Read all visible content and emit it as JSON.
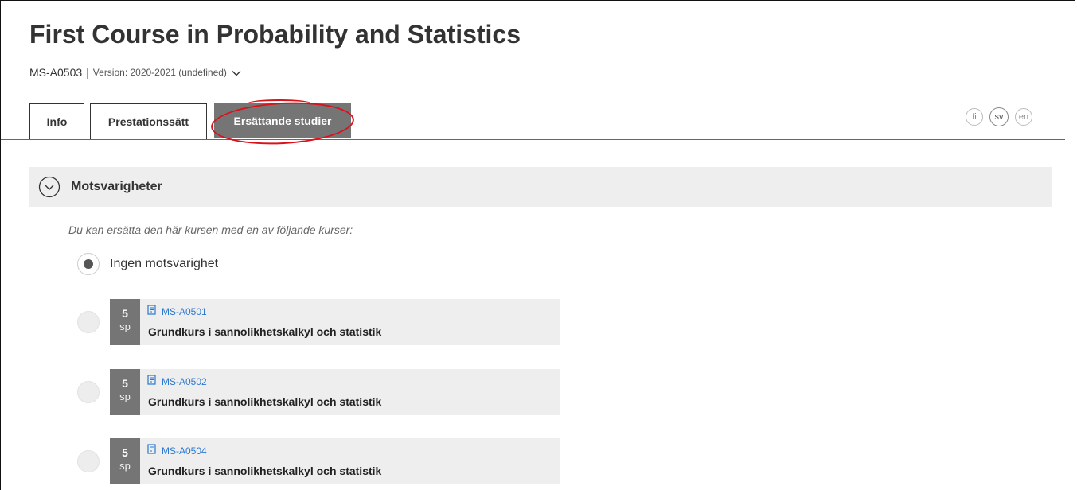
{
  "page": {
    "title": "First Course in Probability and Statistics",
    "course_code": "MS-A0503",
    "separator": "|",
    "version": "Version: 2020-2021 (undefined)"
  },
  "tabs": [
    {
      "label": "Info"
    },
    {
      "label": "Prestationssätt"
    },
    {
      "label": "Ersättande studier"
    }
  ],
  "languages": [
    "fi",
    "sv",
    "en"
  ],
  "section": {
    "label": "Motsvarigheter",
    "intro": "Du kan ersätta den här kursen med en av följande kurser:",
    "none_option": "Ingen motsvarighet"
  },
  "courses": [
    {
      "credits": "5",
      "unit": "sp",
      "code": "MS-A0501",
      "name": "Grundkurs i sannolikhetskalkyl och statistik"
    },
    {
      "credits": "5",
      "unit": "sp",
      "code": "MS-A0502",
      "name": "Grundkurs i sannolikhetskalkyl och statistik"
    },
    {
      "credits": "5",
      "unit": "sp",
      "code": "MS-A0504",
      "name": "Grundkurs i sannolikhetskalkyl och statistik"
    }
  ],
  "colors": {
    "accent_link": "#2b78d0",
    "active_tab": "#757575",
    "annotation": "#d9121b"
  }
}
